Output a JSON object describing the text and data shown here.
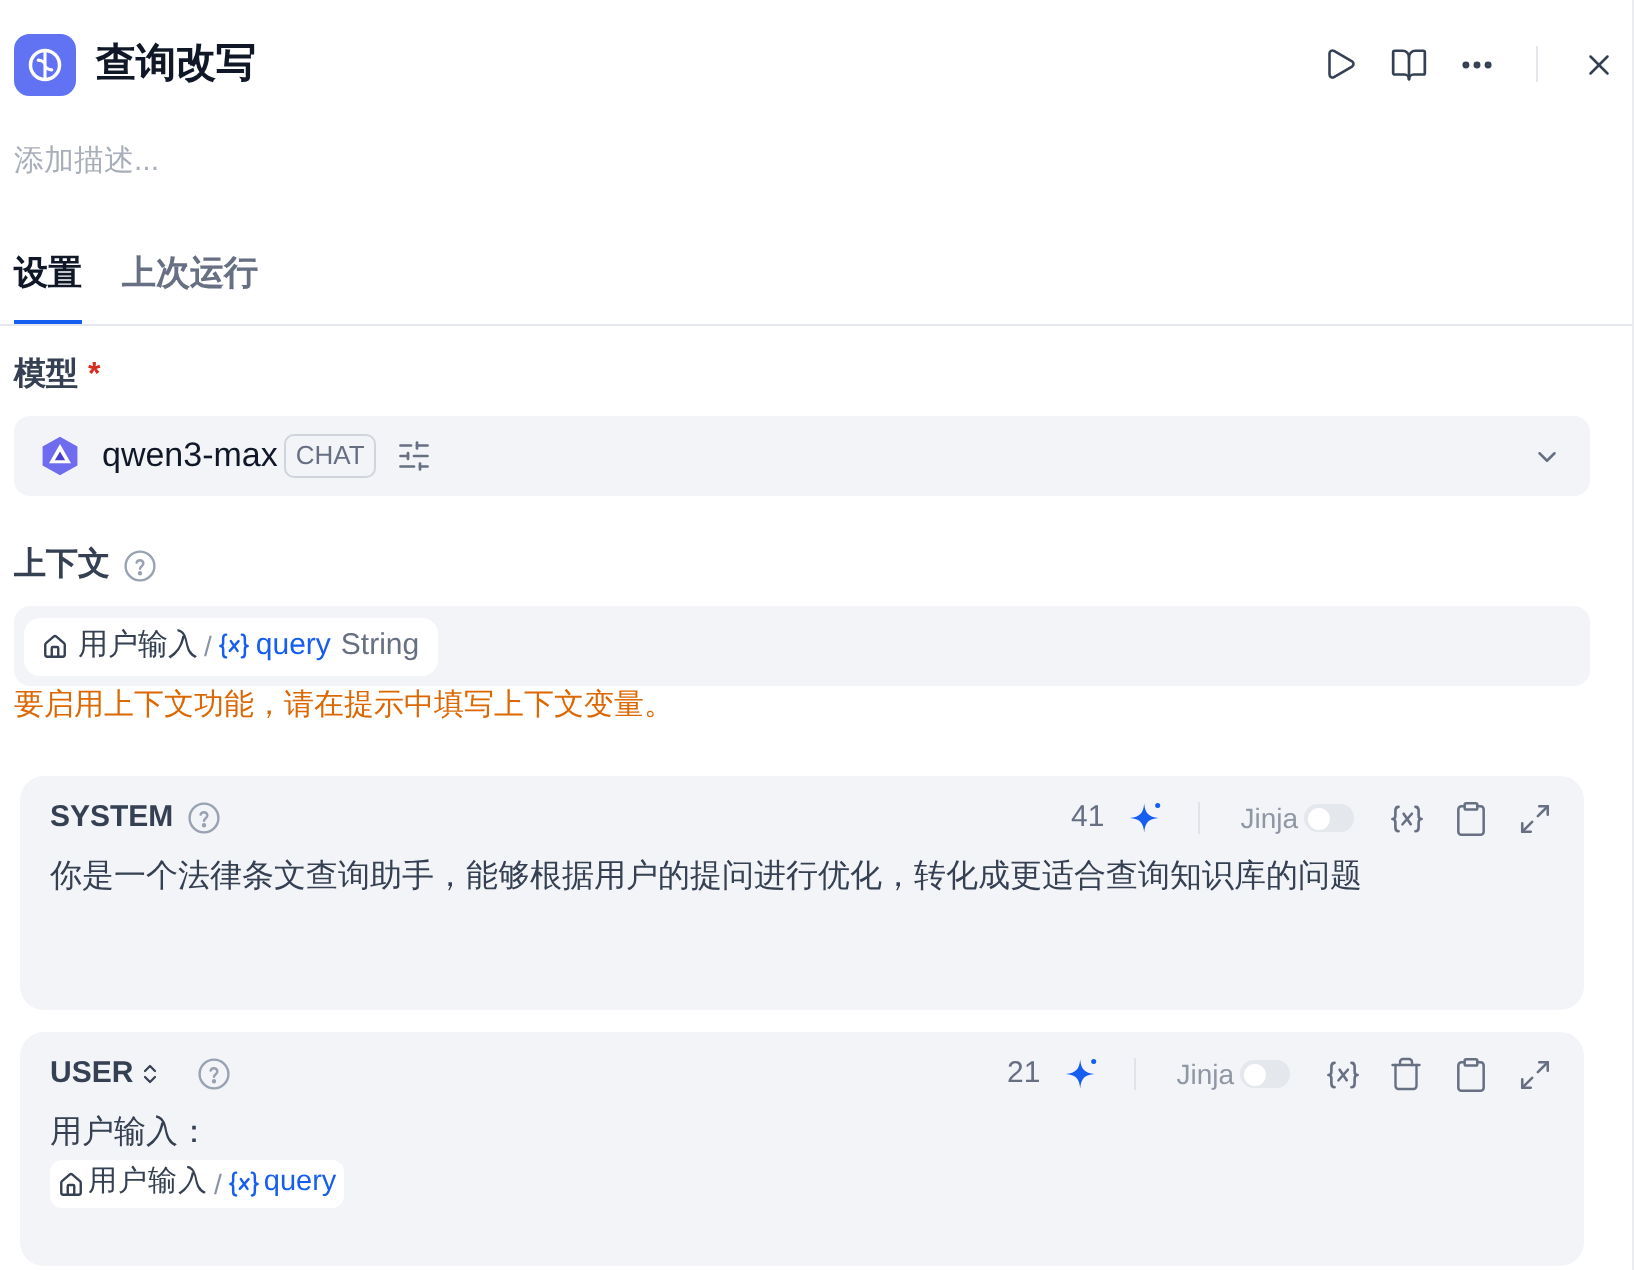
{
  "header": {
    "title": "查询改写"
  },
  "description": {
    "placeholder": "添加描述..."
  },
  "tabs": [
    {
      "label": "设置",
      "selected": true
    },
    {
      "label": "上次运行",
      "selected": false
    }
  ],
  "model": {
    "label": "模型",
    "required_mark": "*",
    "name": "qwen3-max",
    "mode": "CHAT"
  },
  "context": {
    "label": "上下文",
    "variable": {
      "node": "用户输入",
      "separator": "/",
      "name": "query",
      "type": "String"
    },
    "warning": "要启用上下文功能，请在提示中填写上下文变量。"
  },
  "prompts": [
    {
      "role": "SYSTEM",
      "role_switch": false,
      "token_count": "41",
      "jinja_label": "Jinja",
      "jinja_on": false,
      "deletable": false,
      "content": [
        {
          "kind": "text",
          "text": "你是一个法律条文查询助手，能够根据用户的提问进行优化，转化成更适合查询知识库的问题"
        }
      ]
    },
    {
      "role": "USER",
      "role_switch": true,
      "token_count": "21",
      "jinja_label": "Jinja",
      "jinja_on": false,
      "deletable": true,
      "content": [
        {
          "kind": "text",
          "text": "用户输入："
        },
        {
          "kind": "variable",
          "node": "用户输入",
          "separator": "/",
          "name": "query"
        }
      ]
    }
  ]
}
